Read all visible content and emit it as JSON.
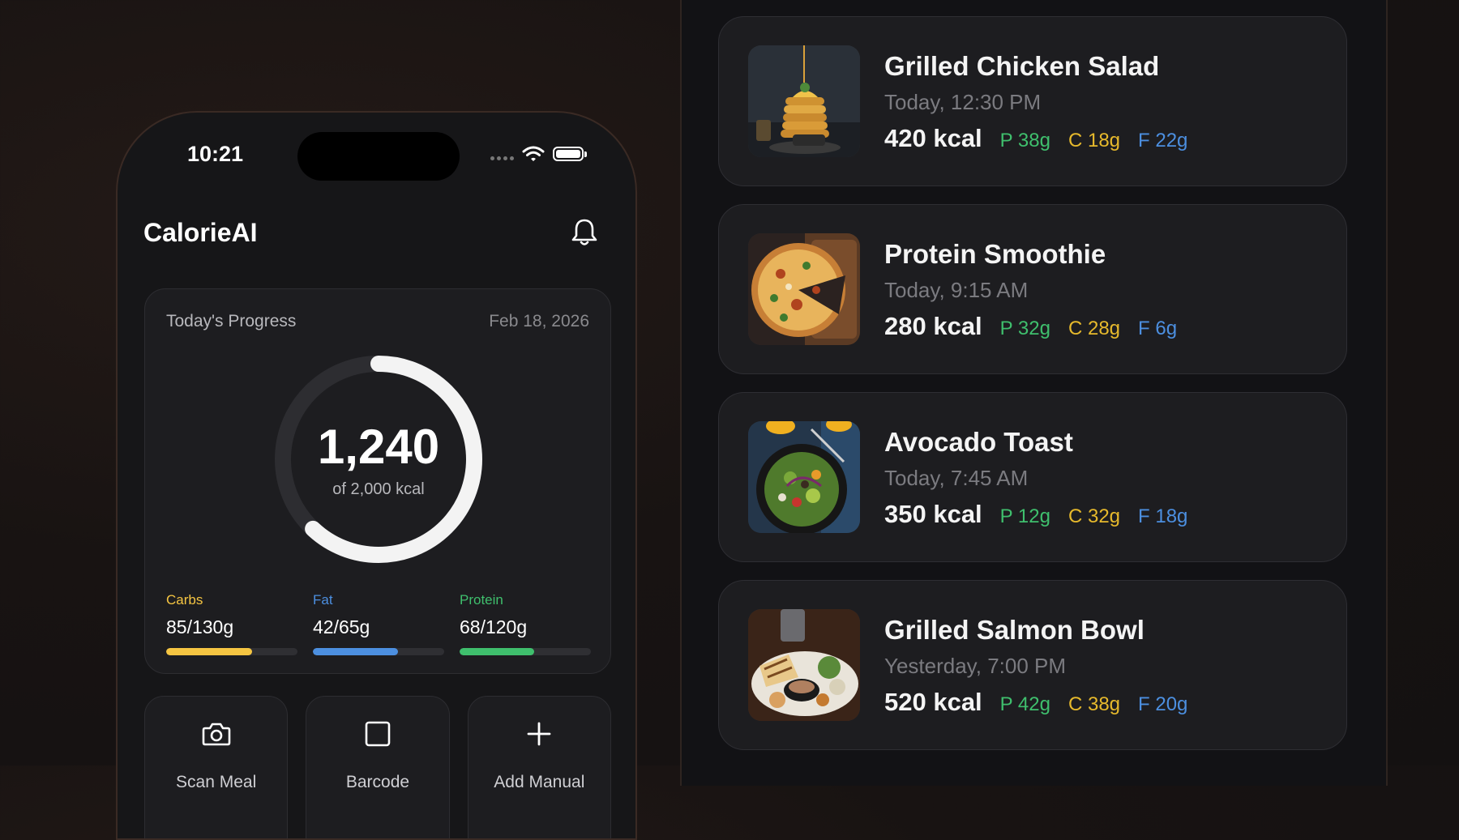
{
  "status_bar": {
    "time": "10:21"
  },
  "app": {
    "title": "CalorieAI"
  },
  "progress": {
    "title": "Today's Progress",
    "date": "Feb 18, 2026",
    "calories": "1,240",
    "calories_goal_text": "of 2,000 kcal",
    "fraction": 0.62,
    "macros": [
      {
        "name": "Carbs",
        "value_text": "85/130g",
        "fraction": 0.654,
        "color": "#f5c542"
      },
      {
        "name": "Fat",
        "value_text": "42/65g",
        "fraction": 0.646,
        "color": "#4c8fe0"
      },
      {
        "name": "Protein",
        "value_text": "68/120g",
        "fraction": 0.567,
        "color": "#3fbf6d"
      }
    ]
  },
  "actions": [
    {
      "label": "Scan Meal",
      "icon": "camera-icon"
    },
    {
      "label": "Barcode",
      "icon": "barcode-icon"
    },
    {
      "label": "Add Manual",
      "icon": "plus-icon"
    }
  ],
  "meals": [
    {
      "name": "Grilled Chicken Salad",
      "time": "Today, 12:30 PM",
      "kcal": "420 kcal",
      "protein": "P 38g",
      "carbs": "C 18g",
      "fat": "F 22g",
      "image": "pancakes-photo"
    },
    {
      "name": "Protein Smoothie",
      "time": "Today, 9:15 AM",
      "kcal": "280 kcal",
      "protein": "P 32g",
      "carbs": "C 28g",
      "fat": "F 6g",
      "image": "pizza-photo"
    },
    {
      "name": "Avocado Toast",
      "time": "Today, 7:45 AM",
      "kcal": "350 kcal",
      "protein": "P 12g",
      "carbs": "C 32g",
      "fat": "F 18g",
      "image": "salad-bowl-photo"
    },
    {
      "name": "Grilled Salmon Bowl",
      "time": "Yesterday, 7:00 PM",
      "kcal": "520 kcal",
      "protein": "P 42g",
      "carbs": "C 38g",
      "fat": "F 20g",
      "image": "grilled-plate-photo"
    }
  ]
}
